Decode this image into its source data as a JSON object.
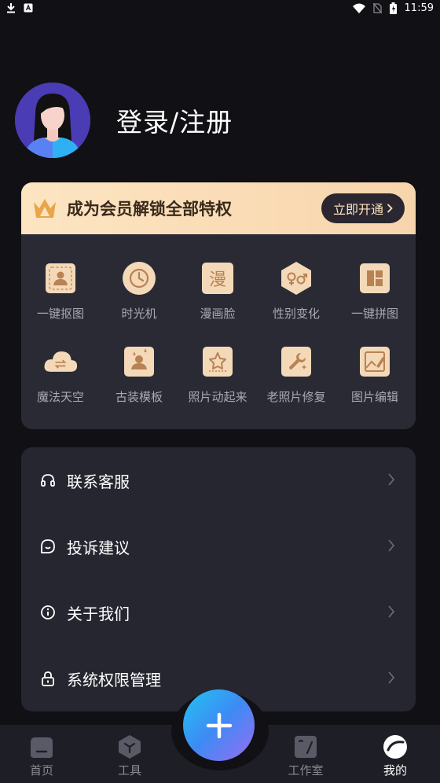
{
  "status_bar": {
    "time": "11:59"
  },
  "profile": {
    "title": "登录/注册"
  },
  "vip": {
    "banner_text": "成为会员解锁全部特权",
    "button_label": "立即开通",
    "accent": "#f7d5ac"
  },
  "tools": [
    {
      "label": "一键抠图",
      "icon": "portrait-cutout-icon"
    },
    {
      "label": "时光机",
      "icon": "clock-icon"
    },
    {
      "label": "漫画脸",
      "icon": "comic-face-icon",
      "glyph": "漫"
    },
    {
      "label": "性别变化",
      "icon": "gender-swap-icon"
    },
    {
      "label": "一键拼图",
      "icon": "collage-icon"
    },
    {
      "label": "魔法天空",
      "icon": "cloud-swap-icon"
    },
    {
      "label": "古装模板",
      "icon": "costume-template-icon"
    },
    {
      "label": "照片动起来",
      "icon": "animate-photo-icon"
    },
    {
      "label": "老照片修复",
      "icon": "repair-wrench-icon"
    },
    {
      "label": "图片编辑",
      "icon": "image-edit-icon"
    }
  ],
  "menu": [
    {
      "label": "联系客服",
      "icon": "headset-icon"
    },
    {
      "label": "投诉建议",
      "icon": "feedback-icon"
    },
    {
      "label": "关于我们",
      "icon": "info-icon"
    },
    {
      "label": "系统权限管理",
      "icon": "lock-icon"
    }
  ],
  "tabs": [
    {
      "label": "首页",
      "icon": "home-icon"
    },
    {
      "label": "工具",
      "icon": "tools-cube-icon"
    },
    {
      "label": "工作室",
      "icon": "studio-icon"
    },
    {
      "label": "我的",
      "icon": "profile-icon"
    }
  ],
  "fab": {
    "icon": "plus-icon"
  }
}
